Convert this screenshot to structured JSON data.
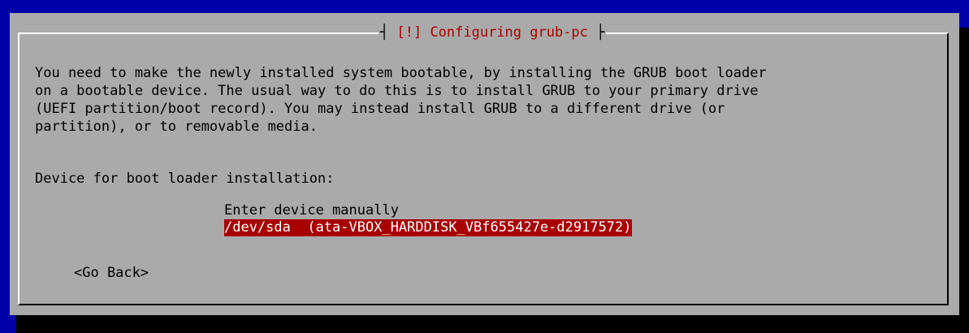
{
  "dialog": {
    "title_text": "[!] Configuring grub-pc",
    "description": "You need to make the newly installed system bootable, by installing the GRUB boot loader\non a bootable device. The usual way to do this is to install GRUB to your primary drive\n(UEFI partition/boot record). You may instead install GRUB to a different drive (or\npartition), or to removable media.",
    "prompt_label": "Device for boot loader installation:",
    "options": [
      {
        "label": "Enter device manually",
        "selected": false
      },
      {
        "label": "/dev/sda  (ata-VBOX_HARDDISK_VBf655427e-d2917572)",
        "selected": true
      }
    ],
    "go_back_label": "<Go Back>"
  },
  "colors": {
    "background": "#0000a8",
    "dialog": "#aaaaaa",
    "title": "#a80000",
    "selection": "#a80000",
    "shadow": "#000000"
  }
}
